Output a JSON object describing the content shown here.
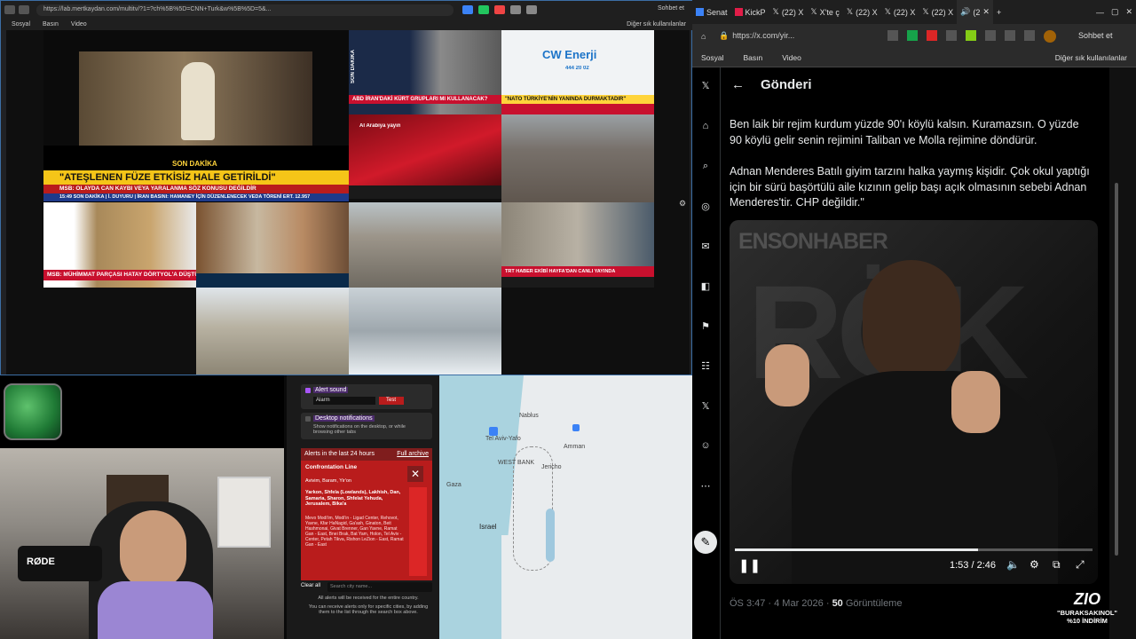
{
  "left_browser": {
    "url": "https://lab.mertkaydan.com/multitv/?1=?ch%5B%5D=CNN+Turk&w%5B%5D=5&...",
    "bookmarks": [
      "Sosyal",
      "Basın",
      "Video"
    ],
    "other_bookmarks": "Diğer sık kullanılanlar",
    "chat_label": "Sohbet et",
    "tiles": {
      "center_banner_tag": "SON DAKİKA",
      "center_banner_headline": "\"ATEŞLENEN FÜZE ETKİSİZ HALE GETİRİLDİ\"",
      "center_banner_sub": "MSB: OLAYDA CAN KAYBI VEYA YARALANMA SÖZ KONUSU DEĞİLDİR",
      "center_ticker": "15:49 SON DAKİKA | İ. DUYURU | İRAN BASINI: HAMANEY İÇİN DÜZENLENECEK VEDA TÖRENİ ERT. 12.957",
      "top_mid_headline": "ABD İRAN'DAKİ KÜRT GRUPLARI MI KULLANACAK?",
      "top_right_logo": "CW Enerji",
      "top_right_phone": "444 20 02",
      "top_right_headline": "\"NATO TÜRKİYE'NİN YANINDA DURMAKTADIR\"",
      "aljazeera_tag": "Al Arabiya yayın",
      "left_mid_headline": "MSB: MÜHİMMAT PARÇASI HATAY DÖRTYOL'A DÜŞTÜ",
      "trt_headline": "TRT HABER EKİBİ HAYFA'DAN CANLI YAYINDA",
      "son_dakika": "SON DAKİKA"
    }
  },
  "alerts_panel": {
    "alert_sound_label": "Alert sound",
    "alarm_select": "Alarm",
    "test_button": "Test",
    "desktop_notifications_label": "Desktop notifications",
    "desktop_notifications_desc": "Show notifications on the desktop, or while browsing other tabs",
    "last24_title": "Alerts in the last 24 hours",
    "full_archive": "Full archive",
    "confrontation_line": "Confrontation Line",
    "confrontation_places": "Avivim, Baram, Yir'on",
    "regions": "Yarkon, Shfela (Lowlands), Lakhish, Dan, Samaria, Sharon, Shfelat Yehuda, Jerusalem, Bika'a",
    "long_list": "Mevo Modi'im, Modi'in - Ligad Center, Rehovot, Yavne, Kfar HaNagid, Ga'ash, Ginaton, Beit Hashmonai, Givat Brenner, Gan Yavne, Ramat Gan - East, Bnei Brak, Bat Yam, Holon, Tel Aviv - Center, Petah Tikva, Rishon LeZion - East, Ramat Gan - East",
    "clear_all": "Clear all",
    "search_placeholder": "Search city name...",
    "all_received": "All alerts will be received for the entire country.",
    "footer_note": "You can receive alerts only for specific cities, by adding them to the list through the search box above."
  },
  "map": {
    "labels": [
      "Tel Aviv-Yafo",
      "Amman",
      "WEST BANK",
      "Gaza",
      "Israel",
      "Nablus",
      "Jericho"
    ]
  },
  "right_browser": {
    "tabs": [
      "Senat",
      "KickP",
      "(22) X",
      "X'te ç",
      "(22) X",
      "(22) X",
      "(22) X",
      "(2"
    ],
    "url": "https://x.com/yir...",
    "chat_label": "Sohbet et",
    "bookmarks": [
      "Sosyal",
      "Basın",
      "Video"
    ],
    "other_bookmarks": "Diğer sık kullanılanlar"
  },
  "post": {
    "header_title": "Gönderi",
    "paragraph1": "Ben laik bir rejim kurdum yüzde 90'ı köylü kalsın. Kuramazsın. O yüzde 90 köylü gelir senin rejimini Taliban ve Molla rejimine döndürür.",
    "paragraph2": "Adnan Menderes Batılı giyim tarzını halka yaymış kişidir. Çok okul yaptığı için bir sürü başörtülü aile kızının gelip başı açık olmasının sebebi Adnan Menderes'tir. CHP değildir.\"",
    "video_watermark": "ENSONHABER",
    "video_bg_letters": "RÖK",
    "video_time": "1:53 / 2:46",
    "video_progress": 0.68,
    "timestamp": "ÖS 3:47 · 4 Mar 2026 · ",
    "views_count": "50",
    "views_label": "Görüntüleme"
  },
  "overlay": {
    "brand": "ZIO",
    "promo1": "\"BURAKSAKINOL\"",
    "promo2": "%10 İNDİRİM"
  }
}
